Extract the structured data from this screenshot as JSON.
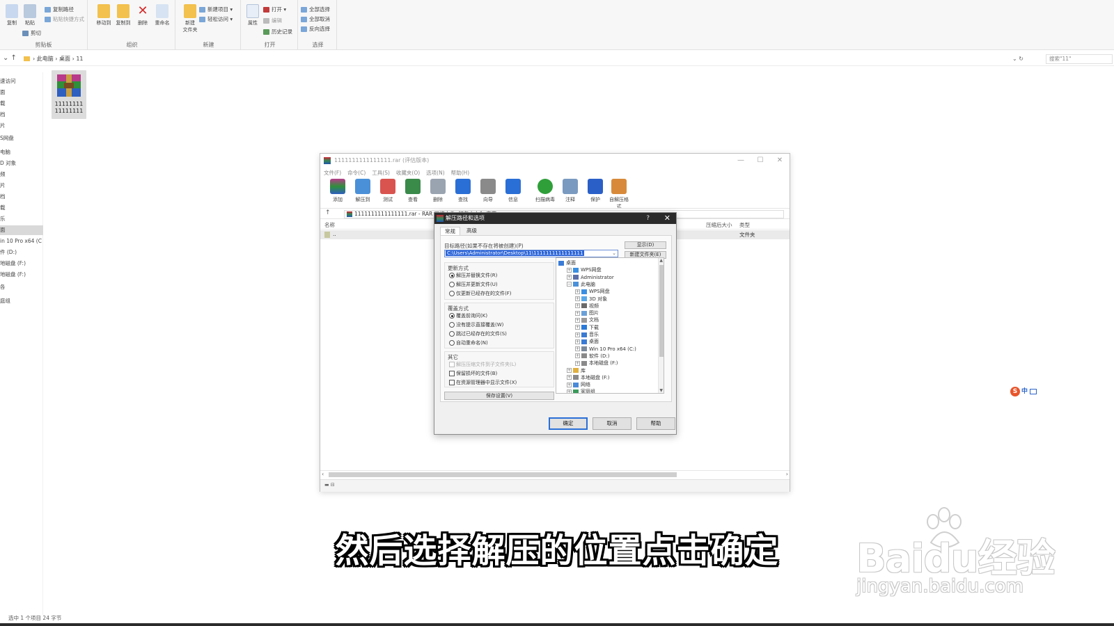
{
  "ribbon": {
    "clipboard": {
      "copy": "复制",
      "paste": "粘贴",
      "copy_path": "复制路径",
      "paste_shortcut": "粘贴快捷方式",
      "cut": "剪切",
      "label": "剪贴板"
    },
    "organize": {
      "move_to": "移动到",
      "copy_to": "复制到",
      "delete": "删除",
      "rename": "重命名",
      "label": "组织"
    },
    "new": {
      "new_folder": "新建\n文件夹",
      "new_item": "新建项目 ▾",
      "easy_access": "轻松访问 ▾",
      "label": "新建"
    },
    "open": {
      "properties": "属性",
      "open": "打开 ▾",
      "edit": "编辑",
      "history": "历史记录",
      "label": "打开"
    },
    "select": {
      "select_all": "全部选择",
      "select_none": "全部取消",
      "invert": "反向选择",
      "label": "选择"
    }
  },
  "address": {
    "crumbs": [
      "此电脑",
      "桌面",
      "11"
    ],
    "search_placeholder": "搜索\"11\""
  },
  "sidebar": {
    "items": [
      "速访问",
      "面",
      "载",
      "档",
      "片",
      "S网盘",
      "电脑",
      "D 对象",
      "频",
      "片",
      "档",
      "载",
      "乐",
      "面",
      "in 10 Pro x64 (C",
      "件 (D:)",
      "地磁盘 (F:)",
      "地磁盘 (F:)",
      "各",
      "庭组"
    ]
  },
  "file": {
    "name": "11111111\n11111111"
  },
  "status_bar": "选中 1 个项目  24 字节",
  "winrar": {
    "title": "1111111111111111.rar (评估版本)",
    "menu": [
      "文件(F)",
      "命令(C)",
      "工具(S)",
      "收藏夹(O)",
      "选项(N)",
      "帮助(H)"
    ],
    "toolbar": [
      "添加",
      "解压到",
      "测试",
      "查看",
      "删除",
      "查找",
      "向导",
      "信息",
      "扫描病毒",
      "注释",
      "保护",
      "自解压格式"
    ],
    "path": "1111111111111111.rar - RAR 压缩文件, 解包大小为 字节",
    "columns": {
      "name": "名称",
      "packed": "压缩后大小",
      "type": "类型"
    },
    "row": {
      "name": "..",
      "type": "文件夹"
    }
  },
  "dialog": {
    "title": "解压路径和选项",
    "help": "?",
    "close": "✕",
    "tabs": [
      "常规",
      "高级"
    ],
    "dest_label": "目标路径(如果不存在将被创建)(P)",
    "dest_value": "C:\\Users\\Administrator\\Desktop\\11\\1111111111111111",
    "show_btn": "显示(D)",
    "new_folder_btn": "新建文件夹(E)",
    "update_mode": {
      "label": "更新方式",
      "options": [
        "解压并替换文件(R)",
        "解压并更新文件(U)",
        "仅更新已经存在的文件(F)"
      ],
      "selected": 0
    },
    "overwrite_mode": {
      "label": "覆盖方式",
      "options": [
        "覆盖前询问(K)",
        "没有提示直接覆盖(W)",
        "跳过已经存在的文件(S)",
        "自动重命名(N)"
      ],
      "selected": 0
    },
    "misc": {
      "label": "其它",
      "options": [
        "解压压缩文件到子文件夹(L)",
        "保留损坏的文件(B)",
        "在资源管理器中显示文件(X)"
      ]
    },
    "save_settings": "保存设置(V)",
    "tree": [
      {
        "label": "桌面",
        "level": 0,
        "exp": "",
        "color": "#3a7bd5"
      },
      {
        "label": "WPS网盘",
        "level": 1,
        "exp": "+",
        "color": "#3a8fe0"
      },
      {
        "label": "Administrator",
        "level": 1,
        "exp": "+",
        "color": "#5a6ea8"
      },
      {
        "label": "此电脑",
        "level": 1,
        "exp": "−",
        "color": "#4a90d9"
      },
      {
        "label": "WPS网盘",
        "level": 2,
        "exp": "+",
        "color": "#3a8fe0"
      },
      {
        "label": "3D 对象",
        "level": 2,
        "exp": "+",
        "color": "#58a8e8"
      },
      {
        "label": "视频",
        "level": 2,
        "exp": "+",
        "color": "#6a6a6a"
      },
      {
        "label": "图片",
        "level": 2,
        "exp": "+",
        "color": "#6aa0d8"
      },
      {
        "label": "文档",
        "level": 2,
        "exp": "+",
        "color": "#9a9a9a"
      },
      {
        "label": "下载",
        "level": 2,
        "exp": "+",
        "color": "#2a7ad8"
      },
      {
        "label": "音乐",
        "level": 2,
        "exp": "+",
        "color": "#3a7ad0"
      },
      {
        "label": "桌面",
        "level": 2,
        "exp": "+",
        "color": "#3a7bd5"
      },
      {
        "label": "Win 10 Pro x64 (C:)",
        "level": 2,
        "exp": "+",
        "color": "#7a8a9a"
      },
      {
        "label": "软件 (D:)",
        "level": 2,
        "exp": "+",
        "color": "#8a8a8a"
      },
      {
        "label": "本地磁盘 (F:)",
        "level": 2,
        "exp": "+",
        "color": "#8a8a8a"
      },
      {
        "label": "库",
        "level": 1,
        "exp": "+",
        "color": "#e0b040"
      },
      {
        "label": "本地磁盘 (F:)",
        "level": 1,
        "exp": "+",
        "color": "#8a8a8a"
      },
      {
        "label": "网络",
        "level": 1,
        "exp": "+",
        "color": "#4a8ad8"
      },
      {
        "label": "家庭组",
        "level": 1,
        "exp": "+",
        "color": "#3a9a5a"
      }
    ],
    "buttons": {
      "ok": "确定",
      "cancel": "取消",
      "help": "帮助"
    }
  },
  "ime": {
    "logo": "S",
    "mode": "中"
  },
  "subtitle": "然后选择解压的位置点击确定",
  "watermark": {
    "brand": "Baidu经验",
    "url": "jingyan.baidu.com"
  }
}
